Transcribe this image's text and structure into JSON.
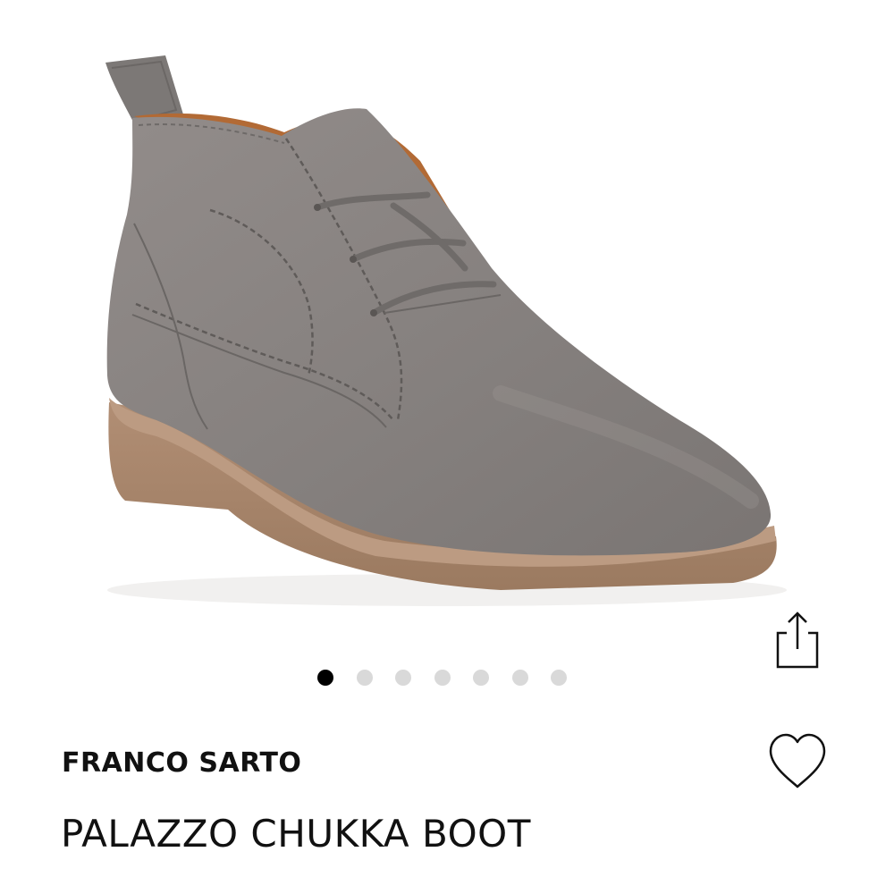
{
  "product": {
    "brand": "FRANCO SARTO",
    "name": "PALAZZO CHUKKA BOOT",
    "image": {
      "subject": "grey suede chukka boot with brown crepe sole",
      "colors": {
        "suede": "#8a8482",
        "sole": "#a9856a",
        "lining": "#b26a35"
      }
    }
  },
  "carousel": {
    "total": 7,
    "active_index": 0,
    "active_color": "#000000",
    "inactive_color": "#d9d9d9"
  },
  "actions": {
    "share_icon": "share-icon",
    "wishlist_icon": "heart-outline-icon"
  }
}
